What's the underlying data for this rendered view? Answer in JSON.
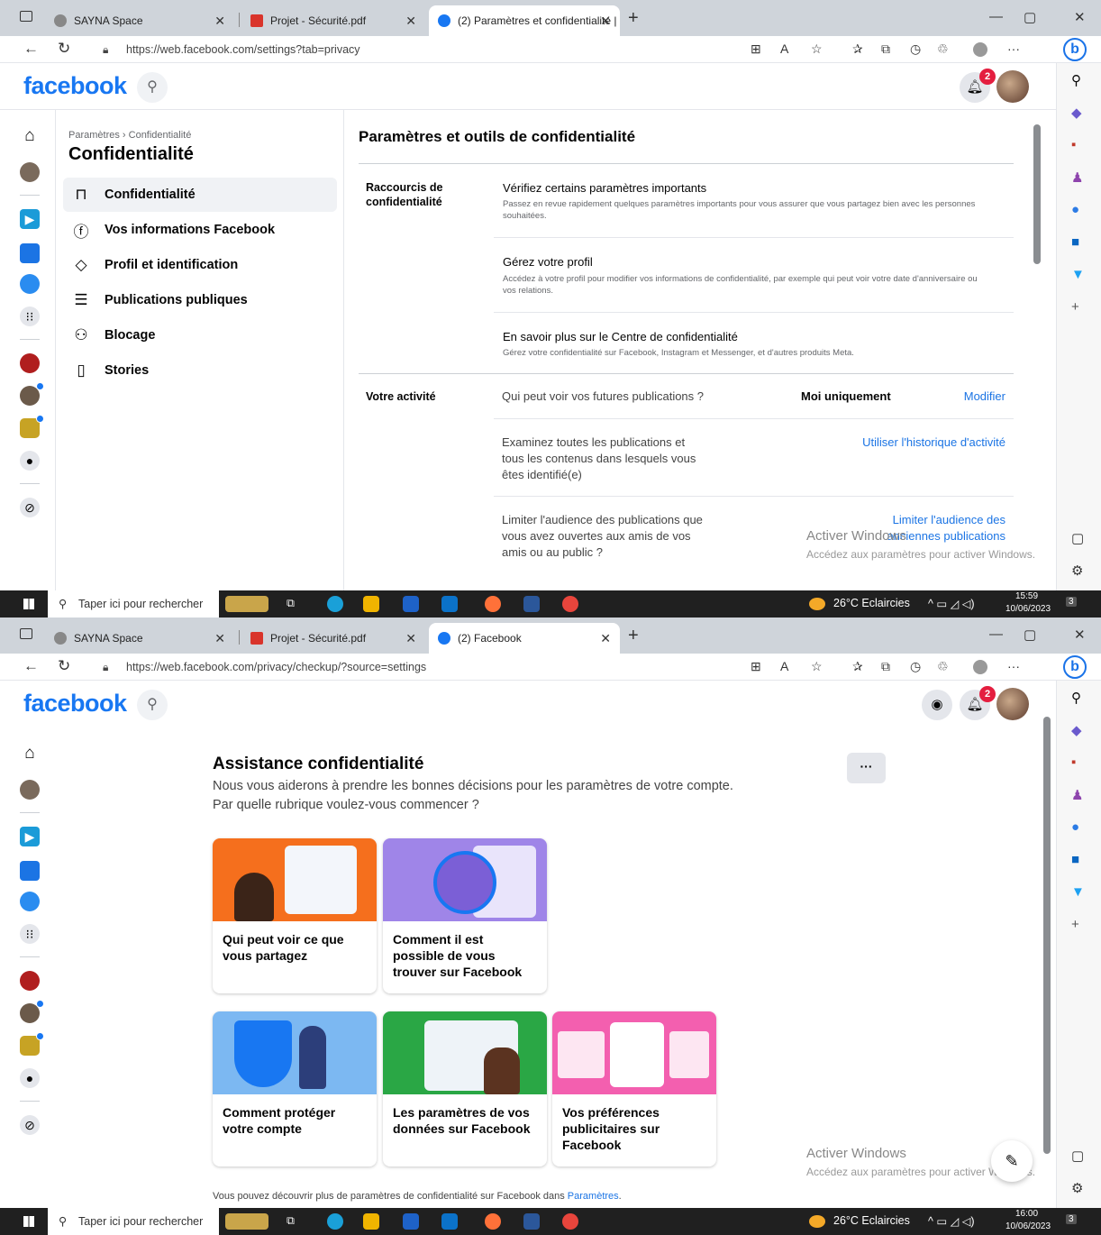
{
  "shot1": {
    "tabs": [
      {
        "label": "SAYNA Space",
        "icon": "sayna-icon"
      },
      {
        "label": "Projet - Sécurité.pdf",
        "icon": "pdf-icon"
      },
      {
        "label": "(2) Paramètres et confidentialité |",
        "icon": "facebook-icon"
      }
    ],
    "url": "https://web.facebook.com/settings?tab=privacy",
    "logo": "facebook",
    "notif_count": "2",
    "breadcrumb": "Paramètres › Confidentialité",
    "side_title": "Confidentialité",
    "side_items": [
      {
        "label": "Confidentialité",
        "icon": "lock-icon"
      },
      {
        "label": "Vos informations Facebook",
        "icon": "facebook-circle-icon"
      },
      {
        "label": "Profil et identification",
        "icon": "tag-icon"
      },
      {
        "label": "Publications publiques",
        "icon": "public-post-icon"
      },
      {
        "label": "Blocage",
        "icon": "blocking-icon"
      },
      {
        "label": "Stories",
        "icon": "book-icon"
      }
    ],
    "main_title": "Paramètres et outils de confidentialité",
    "shortcuts_label": "Raccourcis de confidentialité",
    "shortcuts": [
      {
        "title": "Vérifiez certains paramètres importants",
        "desc": "Passez en revue rapidement quelques paramètres importants pour vous assurer que vous partagez bien avec les personnes souhaitées."
      },
      {
        "title": "Gérez votre profil",
        "desc": "Accédez à votre profil pour modifier vos informations de confidentialité, par exemple qui peut voir votre date d'anniversaire ou vos relations."
      },
      {
        "title": "En savoir plus sur le Centre de confidentialité",
        "desc": "Gérez votre confidentialité sur Facebook, Instagram et Messenger, et d'autres produits Meta."
      }
    ],
    "activity_label": "Votre activité",
    "activity": [
      {
        "text": "Qui peut voir vos futures publications ?",
        "value": "Moi uniquement",
        "action": "Modifier"
      },
      {
        "text": "Examinez toutes les publications et tous les contenus dans lesquels vous êtes identifié(e)",
        "action": "Utiliser l'historique d'activité"
      },
      {
        "text": "Limiter l'audience des publications que vous avez ouvertes aux amis de vos amis ou au public ?",
        "action": "Limiter l'audience des anciennes publications"
      }
    ],
    "time": "15:59",
    "date": "10/06/2023"
  },
  "shot2": {
    "tabs": [
      {
        "label": "SAYNA Space",
        "icon": "sayna-icon"
      },
      {
        "label": "Projet - Sécurité.pdf",
        "icon": "pdf-icon"
      },
      {
        "label": "(2) Facebook",
        "icon": "facebook-icon"
      }
    ],
    "url": "https://web.facebook.com/privacy/checkup/?source=settings",
    "logo": "facebook",
    "notif_count": "2",
    "title": "Assistance confidentialité",
    "subtitle_1": "Nous vous aiderons à prendre les bonnes décisions pour les paramètres de votre compte.",
    "subtitle_2": "Par quelle rubrique voulez-vous commencer ?",
    "more_label": "···",
    "cards": [
      {
        "label": "Qui peut voir ce que vous partagez",
        "color": "#f56f1d"
      },
      {
        "label": "Comment il est possible de vous trouver sur Facebook",
        "color": "#9f85e8"
      },
      {
        "label": "Comment protéger votre compte",
        "color": "#7cb8f2"
      },
      {
        "label": "Les paramètres de vos données sur Facebook",
        "color": "#2aa745"
      },
      {
        "label": "Vos préférences publicitaires sur Facebook",
        "color": "#f35faf"
      }
    ],
    "footer_text": "Vous pouvez découvrir plus de paramètres de confidentialité sur Facebook dans ",
    "footer_link": "Paramètres",
    "footer_end": ".",
    "time": "16:00",
    "date": "10/06/2023"
  },
  "common": {
    "taskbar_search": "Taper ici pour rechercher",
    "weather": "26°C  Eclaircies",
    "watermark_1": "Activer Windows",
    "watermark_2": "Accédez aux paramètres pour activer Windows.",
    "tray_count": "3",
    "accent": "#1877f2",
    "link": "#1b74e4"
  }
}
